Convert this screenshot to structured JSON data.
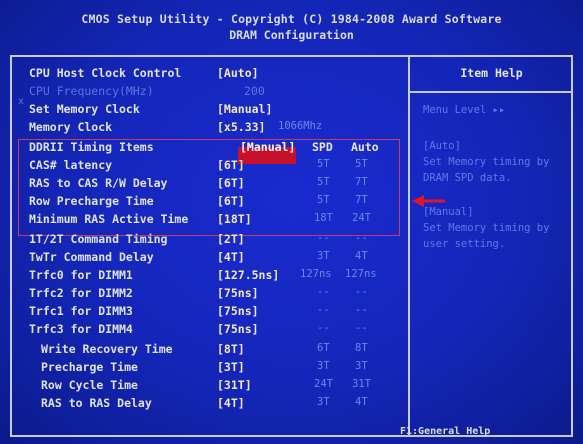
{
  "header": {
    "line1": "CMOS Setup Utility - Copyright (C) 1984-2008 Award Software",
    "line2": "DRAM Configuration"
  },
  "rows": [
    {
      "label": "CPU Host Clock Control",
      "value": "[Auto]",
      "c2": "",
      "c3": ""
    },
    {
      "label": "CPU Frequency(MHz)",
      "value": "200",
      "c2": "",
      "c3": ""
    },
    {
      "label": "Set Memory Clock",
      "value": "[Manual]",
      "c2": "",
      "c3": ""
    },
    {
      "label": "Memory Clock",
      "value": "[x5.33]",
      "c2": "1066Mhz",
      "c3": ""
    },
    {
      "label": "DDRII Timing Items",
      "value": "[Manual]",
      "c2": "SPD",
      "c3": "Auto"
    },
    {
      "label": "CAS# latency",
      "value": "[6T]",
      "c2": "5T",
      "c3": "5T"
    },
    {
      "label": "RAS to CAS R/W Delay",
      "value": "[6T]",
      "c2": "5T",
      "c3": "7T"
    },
    {
      "label": "Row Precharge Time",
      "value": "[6T]",
      "c2": "5T",
      "c3": "7T"
    },
    {
      "label": "Minimum RAS Active Time",
      "value": "[18T]",
      "c2": "18T",
      "c3": "24T"
    },
    {
      "label": "1T/2T Command Timing",
      "value": "[2T]",
      "c2": "--",
      "c3": "--"
    },
    {
      "label": "TwTr Command Delay",
      "value": "[4T]",
      "c2": "3T",
      "c3": "4T"
    },
    {
      "label": "Trfc0 for DIMM1",
      "value": "[127.5ns]",
      "c2": "127ns",
      "c3": "127ns"
    },
    {
      "label": "Trfc2 for DIMM2",
      "value": "[75ns]",
      "c2": "--",
      "c3": "--"
    },
    {
      "label": "Trfc1 for DIMM3",
      "value": "[75ns]",
      "c2": "--",
      "c3": "--"
    },
    {
      "label": "Trfc3 for DIMM4",
      "value": "[75ns]",
      "c2": "--",
      "c3": "--"
    },
    {
      "label": "Write Recovery Time",
      "value": "[8T]",
      "c2": "6T",
      "c3": "8T"
    },
    {
      "label": "Precharge Time",
      "value": "[3T]",
      "c2": "3T",
      "c3": "3T"
    },
    {
      "label": "Row Cycle Time",
      "value": "[31T]",
      "c2": "24T",
      "c3": "31T"
    },
    {
      "label": "RAS to RAS Delay",
      "value": "[4T]",
      "c2": "3T",
      "c3": "4T"
    }
  ],
  "disabled_marker": "x",
  "help": {
    "title": "Item Help",
    "menu_level": "Menu Level   ▸▸",
    "lines": [
      "[Auto]",
      "Set Memory timing by",
      "DRAM SPD data.",
      "[Manual]",
      "Set Memory timing by",
      "user setting."
    ]
  },
  "footer": {
    "text": "F1:General Help"
  },
  "colors": {
    "background": "#1426b8",
    "highlight": "#c9102b",
    "annotation": "#c83a6a"
  }
}
